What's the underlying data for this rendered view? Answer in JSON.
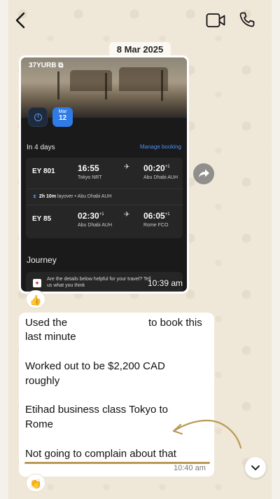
{
  "header": {
    "back_icon": "chevron-left-icon",
    "video_icon": "video-camera-icon",
    "call_icon": "phone-icon"
  },
  "date_separator": "8 Mar 2025",
  "image_message": {
    "booking_code": "37YURB",
    "badge_month": "Mar",
    "badge_day": "12",
    "countdown": "In 4 days",
    "manage_link": "Manage booking",
    "flights": [
      {
        "number": "EY 801",
        "dep_time": "16:55",
        "dep_place": "Tokyo NRT",
        "arr_time": "00:20",
        "arr_day": "+1",
        "arr_place": "Abu Dhabi AUH"
      },
      {
        "number": "EY 85",
        "dep_time": "02:30",
        "dep_day": "+1",
        "dep_place": "Abu Dhabi AUH",
        "arr_time": "06:05",
        "arr_day": "+1",
        "arr_place": "Rome FCO"
      }
    ],
    "layover_duration": "2h 10m",
    "layover_text": "layover • Abu Dhabi AUH",
    "journey_title": "Journey",
    "feedback_text": "Are the details below helpful for your travel? Tell us what you think",
    "time": "10:39 am",
    "reaction": "👍"
  },
  "text_message": {
    "line1_start": "Used the",
    "line1_end": "to book this",
    "line2": "last minute",
    "para2_line1": "Worked out to be $2,200 CAD",
    "para2_line2": "roughly",
    "para3_line1": "Etihad business class Tokyo to",
    "para3_line2": "Rome",
    "para4": "Not going to complain about that",
    "time": "10:40 am",
    "reaction": "👏"
  },
  "colors": {
    "chat_background": "#efe7d8",
    "bubble": "#ffffff",
    "annotation_gold": "#b89a55",
    "link_blue": "#4e8ff0"
  }
}
